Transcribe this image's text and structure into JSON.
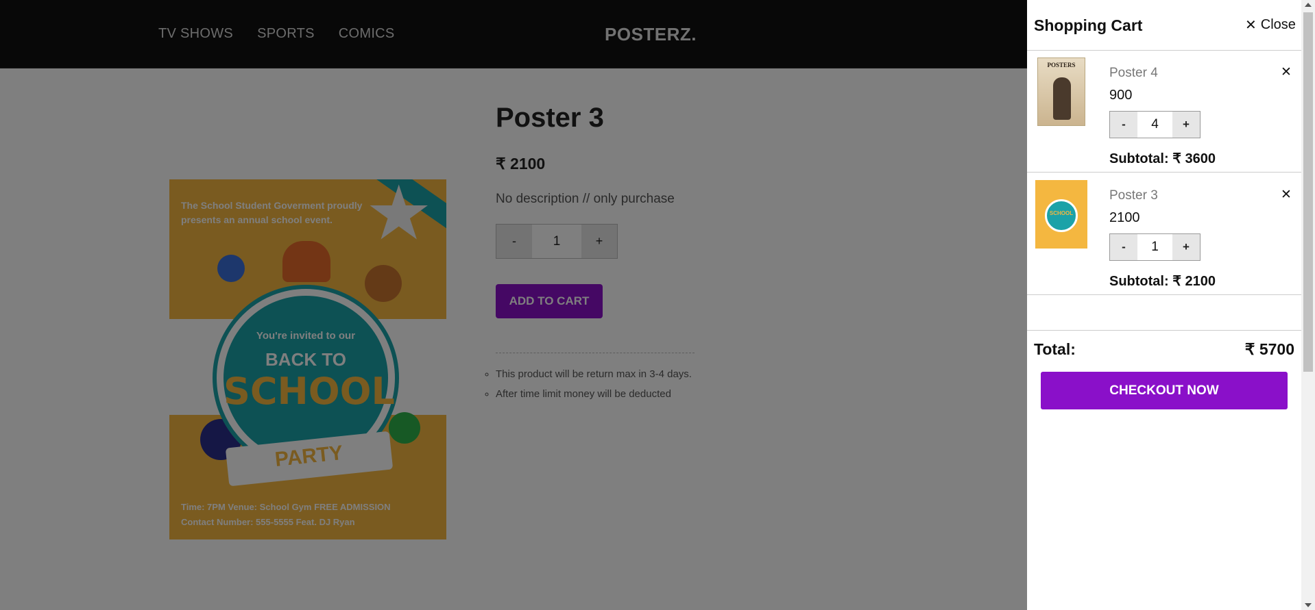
{
  "header": {
    "nav": [
      "TV SHOWS",
      "SPORTS",
      "COMICS"
    ],
    "logo": "POSTERZ."
  },
  "product": {
    "title": "Poster 3",
    "price": "₹ 2100",
    "description": "No description // only purchase",
    "qty": {
      "minus": "-",
      "value": "1",
      "plus": "+"
    },
    "add_to_cart": "ADD TO CART",
    "policies": [
      "This product will be return max in 3-4 days.",
      "After time limit money will be deducted"
    ],
    "poster_art": {
      "top_text": "The School Student Goverment proudly presents an annual school event.",
      "line1": "You're invited to our",
      "line2": "BACK TO",
      "line3": "SCHOOL",
      "ribbon": "PARTY",
      "bottom_line1": "Time: 7PM    Venue: School Gym    FREE ADMISSION",
      "bottom_line2": "Contact Number: 555-5555    Feat. DJ Ryan"
    }
  },
  "cart": {
    "title": "Shopping Cart",
    "close_label": "Close",
    "items": [
      {
        "name": "Poster 4",
        "price": "900",
        "qty": "4",
        "subtotal": "Subtotal: ₹ 3600",
        "thumb_text": "POSTERS"
      },
      {
        "name": "Poster 3",
        "price": "2100",
        "qty": "1",
        "subtotal": "Subtotal: ₹ 2100",
        "thumb_text": "SCHOOL"
      }
    ],
    "stepper": {
      "minus": "-",
      "plus": "+"
    },
    "remove_glyph": "✕",
    "total_label": "Total:",
    "total_value": "₹ 5700",
    "checkout": "CHECKOUT NOW"
  },
  "colors": {
    "accent": "#8a10c9",
    "header_bg": "#111111"
  }
}
